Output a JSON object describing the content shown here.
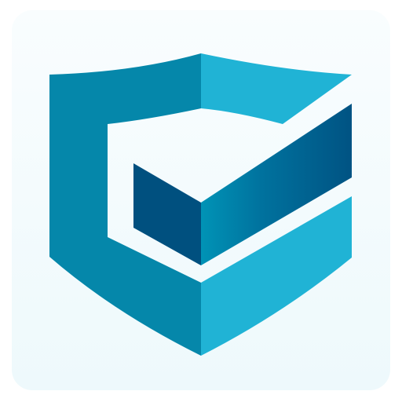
{
  "icon": {
    "name": "shield-check-icon",
    "colors": {
      "tile_background": "#f3fbfd",
      "shield_dark": "#0587aa",
      "shield_light": "#20b3d5",
      "check_dark": "#00507f",
      "check_mid": "#008eb1"
    }
  }
}
